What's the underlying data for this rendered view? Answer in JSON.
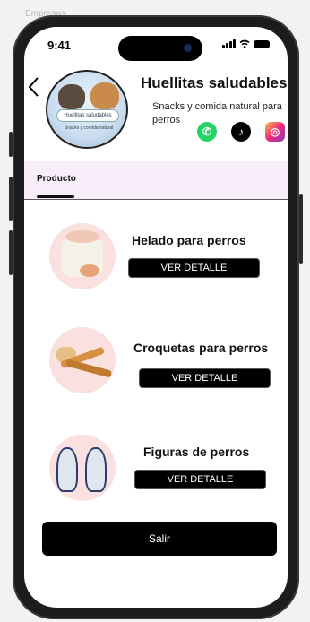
{
  "canvas": {
    "label": "Empresas"
  },
  "status_bar": {
    "time": "9:41"
  },
  "store": {
    "name": "Huellitas saludables",
    "description": "Snacks y comida natural para perros",
    "logo_text": "Huellitas saludables",
    "logo_subtext": "Snacks y comida natural"
  },
  "social": [
    {
      "name": "whatsapp-icon",
      "glyph": "✆"
    },
    {
      "name": "tiktok-icon",
      "glyph": "♪"
    },
    {
      "name": "instagram-icon",
      "glyph": "◎"
    }
  ],
  "tabs": [
    {
      "label": "Producto",
      "active": true
    }
  ],
  "products": [
    {
      "name": "Helado para perros",
      "button": "VER DETALLE"
    },
    {
      "name": "Croquetas para perros",
      "button": "VER DETALLE"
    },
    {
      "name": "Figuras de perros",
      "button": "VER DETALLE"
    }
  ],
  "footer": {
    "exit_label": "Salir"
  },
  "colors": {
    "accent": "#000000",
    "tab_bg": "#f8eefa",
    "thumb_bg": "#fbe0e0"
  }
}
